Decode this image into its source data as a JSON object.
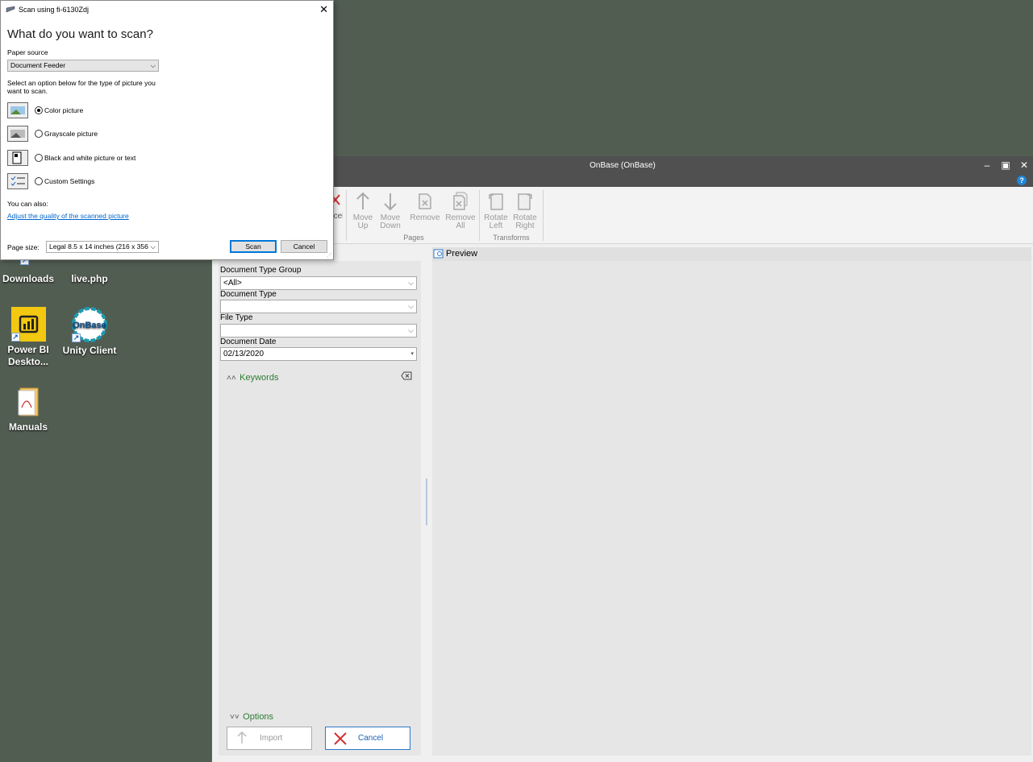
{
  "desktop": {
    "icons": [
      {
        "label": "Downloads"
      },
      {
        "label": "live.php"
      },
      {
        "label": "Power BI Deskto..."
      },
      {
        "label": "Unity Client",
        "logo_text": "OnBase"
      },
      {
        "label": "Manuals"
      }
    ]
  },
  "onbase": {
    "title": "OnBase (OnBase)",
    "help": "?",
    "ribbon": {
      "partial": "cel",
      "move_up": [
        "Move",
        "Up"
      ],
      "move_down": [
        "Move",
        "Down"
      ],
      "remove": "Remove",
      "remove_all": [
        "Remove",
        "All"
      ],
      "pages_group": "Pages",
      "rotate_left": [
        "Rotate",
        "Left"
      ],
      "rotate_right": [
        "Rotate",
        "Right"
      ],
      "transforms_group": "Transforms"
    },
    "fields": {
      "doc_type_group_label": "Document Type Group",
      "doc_type_group_value": "<All>",
      "doc_type_label": "Document Type",
      "doc_type_value": "",
      "file_type_label": "File Type",
      "file_type_value": "",
      "doc_date_label": "Document Date",
      "doc_date_value": "02/13/2020"
    },
    "keywords": "Keywords",
    "options": "Options",
    "import": "Import",
    "cancel": "Cancel",
    "preview": "Preview",
    "colors": {
      "accent_green": "#2e7d32",
      "title_bar": "#505050",
      "cancel_x": "#d32f2f"
    }
  },
  "scan_dialog": {
    "title": "Scan using fi-6130Zdj",
    "heading": "What do you want to scan?",
    "paper_source_label": "Paper source",
    "paper_source_value": "Document Feeder",
    "instruction": "Select an option below for the type of picture you want to scan.",
    "options": [
      {
        "label": "Color picture",
        "selected": true
      },
      {
        "label": "Grayscale picture",
        "selected": false
      },
      {
        "label": "Black and white picture or text",
        "selected": false
      },
      {
        "label": "Custom Settings",
        "selected": false
      }
    ],
    "you_can_also": "You can also:",
    "adjust_link": "Adjust the quality of the scanned picture",
    "page_size_label": "Page size:",
    "page_size_value": "Legal 8.5 x 14 inches (216 x 356",
    "scan_button": "Scan",
    "cancel_button": "Cancel"
  }
}
